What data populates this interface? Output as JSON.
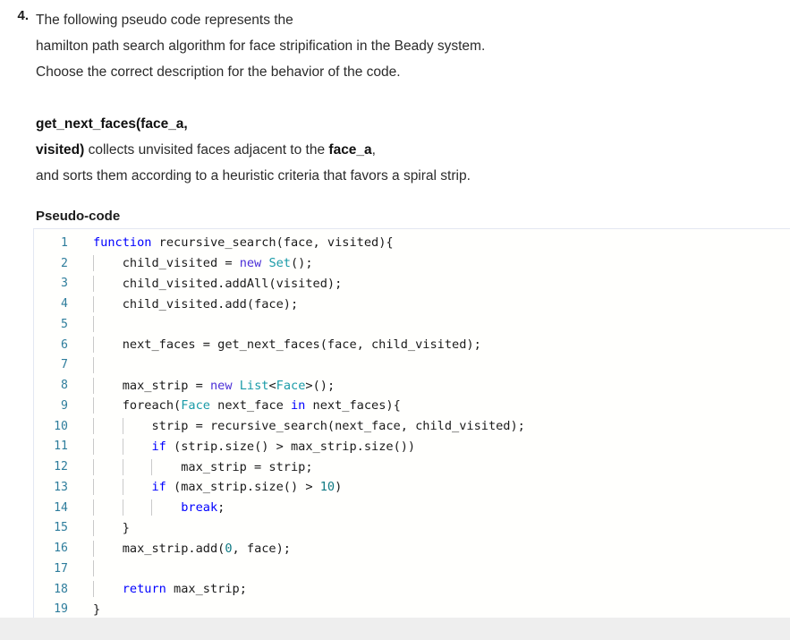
{
  "question": {
    "number": "4.",
    "lines": [
      "The following pseudo code represents the",
      "hamilton path search algorithm for face stripification in the Beady system.",
      "Choose the correct description for the behavior of the code."
    ],
    "definition": {
      "line1_bold": "get_next_faces(face_a,",
      "line2_bold_a": "visited)",
      "line2_rest_a": " collects unvisited faces adjacent to the ",
      "line2_bold_b": "face_a",
      "line2_rest_b": ",",
      "line3": "and sorts them according to a heuristic criteria that favors a spiral strip."
    },
    "section_title": "Pseudo-code"
  },
  "code": {
    "language": "pseudocode",
    "line_count": 19,
    "line_numbers": [
      "1",
      "2",
      "3",
      "4",
      "5",
      "6",
      "7",
      "8",
      "9",
      "10",
      "11",
      "12",
      "13",
      "14",
      "15",
      "16",
      "17",
      "18",
      "19"
    ],
    "lines": [
      "function recursive_search(face, visited){",
      "    child_visited = new Set();",
      "    child_visited.addAll(visited);",
      "    child_visited.add(face);",
      "",
      "    next_faces = get_next_faces(face, child_visited);",
      "",
      "    max_strip = new List<Face>();",
      "    foreach(Face next_face in next_faces){",
      "        strip = recursive_search(next_face, child_visited);",
      "        if (strip.size() > max_strip.size())",
      "            max_strip = strip;",
      "        if (max_strip.size() > 10)",
      "            break;",
      "    }",
      "    max_strip.add(0, face);",
      "",
      "    return max_strip;",
      "}"
    ],
    "tokens": [
      [
        {
          "t": "function",
          "c": "kw"
        },
        {
          "t": " recursive_search(face, visited){",
          "c": "pln"
        }
      ],
      [
        {
          "t": "    child_visited = ",
          "c": "pln"
        },
        {
          "t": "new",
          "c": "kw2"
        },
        {
          "t": " ",
          "c": "pln"
        },
        {
          "t": "Set",
          "c": "typ"
        },
        {
          "t": "();",
          "c": "pln"
        }
      ],
      [
        {
          "t": "    child_visited.addAll(visited);",
          "c": "pln"
        }
      ],
      [
        {
          "t": "    child_visited.add(face);",
          "c": "pln"
        }
      ],
      [],
      [
        {
          "t": "    next_faces = get_next_faces(face, child_visited);",
          "c": "pln"
        }
      ],
      [],
      [
        {
          "t": "    max_strip = ",
          "c": "pln"
        },
        {
          "t": "new",
          "c": "kw2"
        },
        {
          "t": " ",
          "c": "pln"
        },
        {
          "t": "List",
          "c": "typ"
        },
        {
          "t": "<",
          "c": "pln"
        },
        {
          "t": "Face",
          "c": "typ"
        },
        {
          "t": ">();",
          "c": "pln"
        }
      ],
      [
        {
          "t": "    foreach(",
          "c": "pln"
        },
        {
          "t": "Face",
          "c": "typ"
        },
        {
          "t": " next_face ",
          "c": "pln"
        },
        {
          "t": "in",
          "c": "kw"
        },
        {
          "t": " next_faces){",
          "c": "pln"
        }
      ],
      [
        {
          "t": "        strip = recursive_search(next_face, child_visited);",
          "c": "pln"
        }
      ],
      [
        {
          "t": "        ",
          "c": "pln"
        },
        {
          "t": "if",
          "c": "kw"
        },
        {
          "t": " (strip.size() > max_strip.size())",
          "c": "pln"
        }
      ],
      [
        {
          "t": "            max_strip = strip;",
          "c": "pln"
        }
      ],
      [
        {
          "t": "        ",
          "c": "pln"
        },
        {
          "t": "if",
          "c": "kw"
        },
        {
          "t": " (max_strip.size() > ",
          "c": "pln"
        },
        {
          "t": "10",
          "c": "num"
        },
        {
          "t": ")",
          "c": "pln"
        }
      ],
      [
        {
          "t": "            ",
          "c": "pln"
        },
        {
          "t": "break",
          "c": "kw"
        },
        {
          "t": ";",
          "c": "pln"
        }
      ],
      [
        {
          "t": "    }",
          "c": "pln"
        }
      ],
      [
        {
          "t": "    max_strip.add(",
          "c": "pln"
        },
        {
          "t": "0",
          "c": "num"
        },
        {
          "t": ", face);",
          "c": "pln"
        }
      ],
      [],
      [
        {
          "t": "    ",
          "c": "pln"
        },
        {
          "t": "return",
          "c": "kw"
        },
        {
          "t": " max_strip;",
          "c": "pln"
        }
      ],
      [
        {
          "t": "}",
          "c": "pln"
        }
      ]
    ],
    "guides_per_line": [
      0,
      1,
      1,
      1,
      1,
      1,
      1,
      1,
      1,
      2,
      2,
      3,
      2,
      3,
      1,
      1,
      1,
      1,
      0
    ]
  },
  "colors": {
    "keyword": "#0000ff",
    "keyword_new": "#4b2fd8",
    "type": "#1a9ba8",
    "number": "#107a84",
    "plain": "#1a1a1a",
    "line_number": "#2e7d9c",
    "code_border": "#e3e7f2",
    "code_background": "#fffffd",
    "body_text": "#2b2b2b",
    "page_edge": "#eeeeee"
  }
}
